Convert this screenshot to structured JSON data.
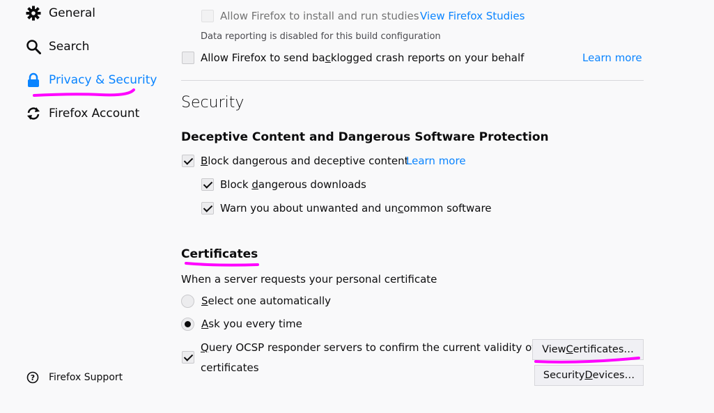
{
  "sidebar": {
    "items": [
      {
        "label": "General",
        "icon": "gear-icon"
      },
      {
        "label": "Search",
        "icon": "search-icon"
      },
      {
        "label": "Privacy & Security",
        "icon": "lock-icon",
        "active": true
      },
      {
        "label": "Firefox Account",
        "icon": "sync-icon"
      }
    ],
    "support_label": "Firefox Support"
  },
  "data_collection": {
    "studies_label": "Allow Firefox to install and run studies",
    "studies_link": "View Firefox Studies",
    "disabled_note": "Data reporting is disabled for this build configuration",
    "crash_reports_pre": "Allow Firefox to send ba",
    "crash_reports_key": "c",
    "crash_reports_post": "klogged crash reports on your behalf",
    "learn_more": "Learn more"
  },
  "security": {
    "heading": "Security",
    "protection_heading": "Deceptive Content and Dangerous Software Protection",
    "block_key": "B",
    "block_rest": "lock dangerous and deceptive content",
    "learn_more": "Learn more",
    "downloads_pre": "Block ",
    "downloads_key": "d",
    "downloads_post": "angerous downloads",
    "unwanted_pre": "Warn you about unwanted and un",
    "unwanted_key": "c",
    "unwanted_post": "ommon software"
  },
  "certificates": {
    "heading": "Certificates",
    "description": "When a server requests your personal certificate",
    "select_key": "S",
    "select_rest": "elect one automatically",
    "ask_key": "A",
    "ask_rest": "sk you every time",
    "ocsp_key": "Q",
    "ocsp_line1_rest": "uery OCSP responder servers to confirm the current validity of",
    "ocsp_line2": "certificates",
    "view_pre": "View ",
    "view_key": "C",
    "view_post": "ertificates…",
    "devices_pre": "Security ",
    "devices_key": "D",
    "devices_post": "evices…"
  },
  "colors": {
    "accent": "#0a84ff",
    "highlight": "#ff00ff"
  }
}
